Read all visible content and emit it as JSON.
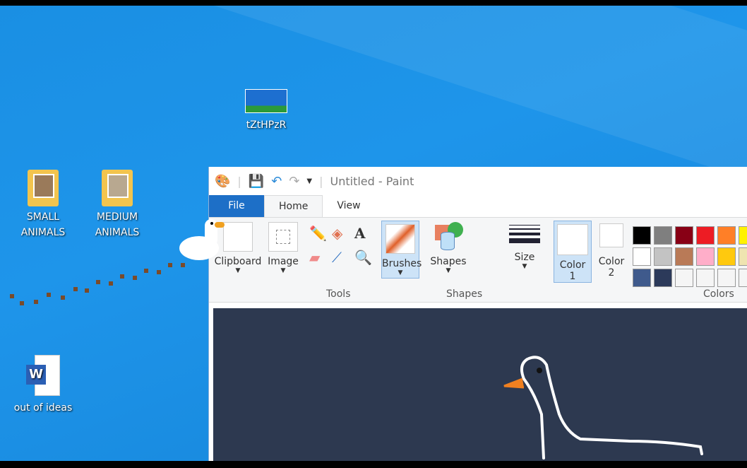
{
  "desktop": {
    "icons": [
      {
        "label": "tZtHPzR"
      },
      {
        "label": "SMALL\nANIMALS",
        "line1": "SMALL",
        "line2": "ANIMALS"
      },
      {
        "label": "MEDIUM ANIMALS",
        "line1": "MEDIUM",
        "line2": "ANIMALS"
      },
      {
        "label": "out of ideas"
      }
    ]
  },
  "paint": {
    "title": "Untitled - Paint",
    "tabs": [
      "File",
      "Home",
      "View"
    ],
    "groups": {
      "clipboard": "Clipboard",
      "image": "Image",
      "tools": "Tools",
      "brushes": "Brushes",
      "shapes_btn": "Shapes",
      "shapes": "Shapes",
      "size": "Size",
      "color1": "Color",
      "color1n": "1",
      "color2": "Color",
      "color2n": "2",
      "colors": "Colors"
    },
    "palette": [
      [
        "#000000",
        "#7f7f7f",
        "#880015",
        "#ed1c24",
        "#ff7f27",
        "#fff200"
      ],
      [
        "#ffffff",
        "#c3c3c3",
        "#b97a57",
        "#ffaec9",
        "#ffc90e",
        "#efe4b0"
      ],
      [
        "#3f5a8c",
        "#2c3a5a",
        "#f5f5f5",
        "#f5f5f5",
        "#f5f5f5",
        "#f5f5f5"
      ]
    ],
    "color1": "#ffffff",
    "color2": "#ffffff",
    "canvas_bg": "#2d3950"
  }
}
